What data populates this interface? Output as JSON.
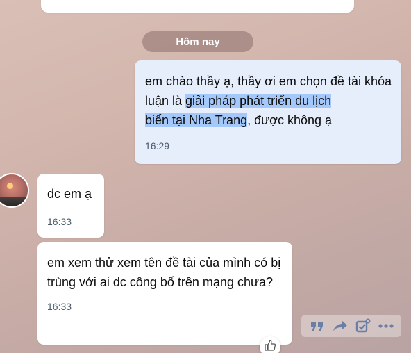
{
  "date_separator": "Hôm nay",
  "messages": [
    {
      "side": "sent",
      "text_before": "em chào thầy ạ, thầy ơi em chọn đề tài khóa luận là ",
      "text_highlight_1": "giải pháp phát triển du lịch",
      "text_highlight_2": "biển tại Nha Trang",
      "text_after": ", được không ạ",
      "time": "16:29"
    },
    {
      "side": "received",
      "text": "dc em ạ",
      "time": "16:33"
    },
    {
      "side": "received",
      "text": "em xem thử xem tên đề tài của mình có bị trùng với ai dc công bố trên mạng chưa?",
      "time": "16:33"
    }
  ],
  "toolbar": {
    "icons": [
      "quote-icon",
      "forward-icon",
      "task-icon",
      "more-icon"
    ]
  },
  "colors": {
    "sent_bubble": "#e6eefc",
    "received_bubble": "#ffffff",
    "highlight": "#a5c8fa",
    "toolbar_icon": "#6a7fa6"
  }
}
